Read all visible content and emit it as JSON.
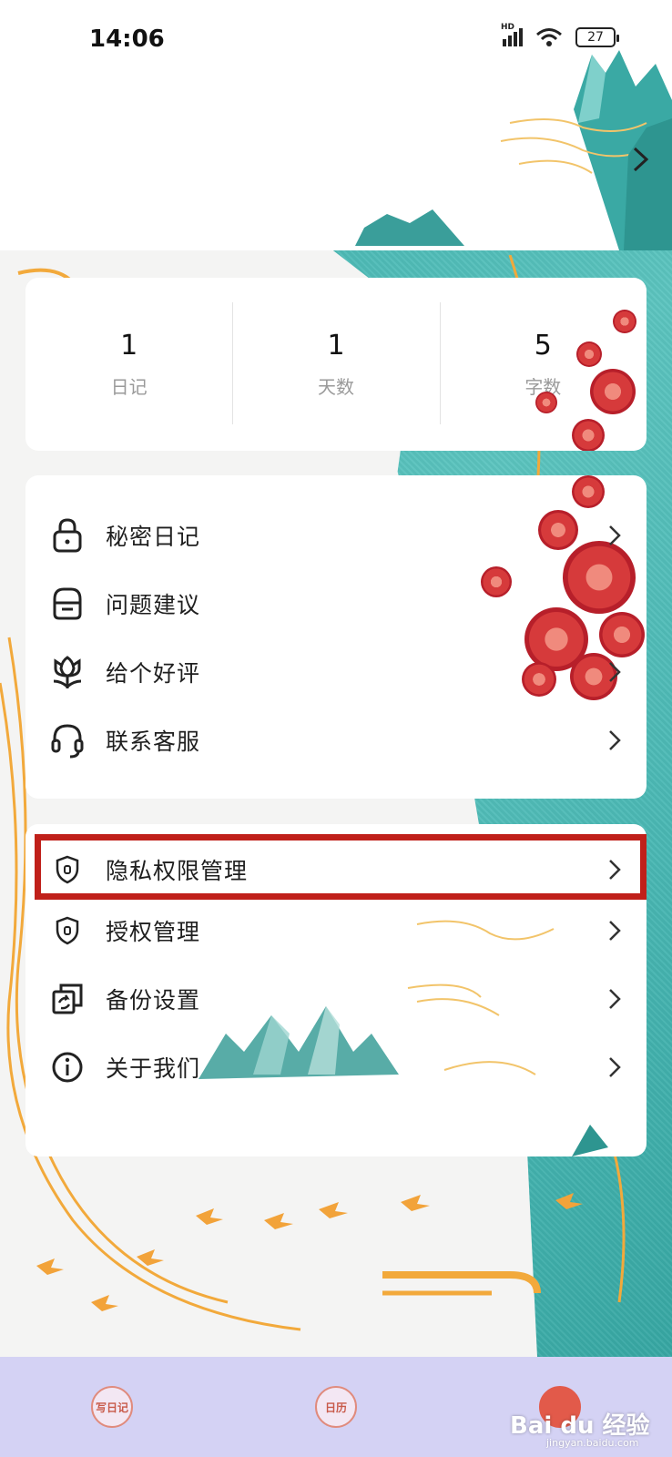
{
  "status_bar": {
    "time": "14:06",
    "network": "HD",
    "battery": "27"
  },
  "stats": [
    {
      "value": "1",
      "label": "日记"
    },
    {
      "value": "1",
      "label": "天数"
    },
    {
      "value": "5",
      "label": "字数"
    }
  ],
  "menu_group_1": [
    {
      "label": "秘密日记",
      "icon": "lock-icon"
    },
    {
      "label": "问题建议",
      "icon": "feedback-box-icon"
    },
    {
      "label": "给个好评",
      "icon": "flower-icon"
    },
    {
      "label": "联系客服",
      "icon": "headset-icon"
    }
  ],
  "menu_group_2": [
    {
      "label": "隐私权限管理",
      "icon": "shield-icon"
    },
    {
      "label": "授权管理",
      "icon": "shield-icon"
    },
    {
      "label": "备份设置",
      "icon": "sync-icon"
    },
    {
      "label": "关于我们",
      "icon": "info-icon"
    }
  ],
  "bottom_nav": [
    {
      "label": "写日记"
    },
    {
      "label": "日历"
    }
  ],
  "watermark": {
    "brand": "Bai du 经验",
    "url": "jingyan.baidu.com"
  },
  "colors": {
    "highlight": "#c0201a",
    "teal": "#46b5b1",
    "nav_bg": "#d4d2f4"
  }
}
